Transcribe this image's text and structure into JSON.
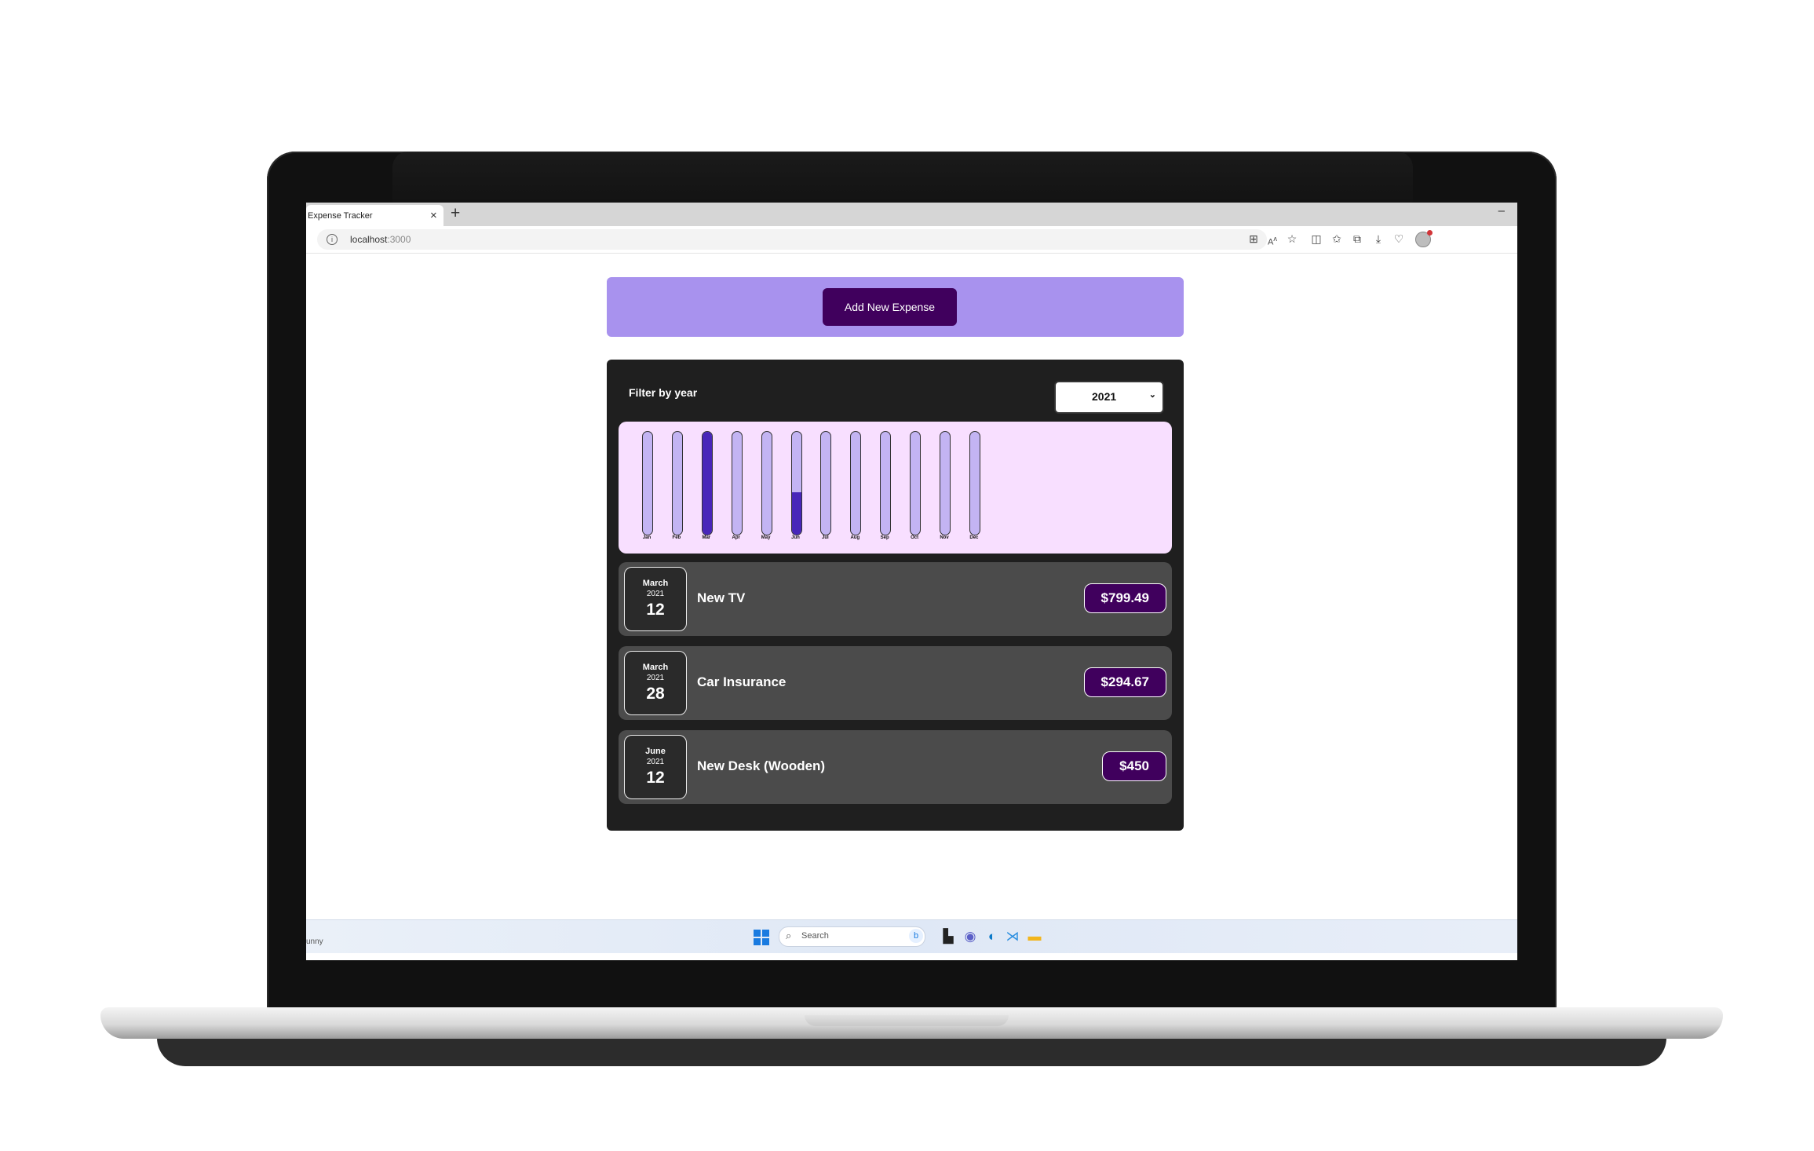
{
  "browser": {
    "tab_title": "Expense Tracker",
    "tab_close": "×",
    "new_tab": "+",
    "minimize": "–",
    "url_host": "localhost",
    "url_port": ":3000"
  },
  "toolbar_icons": [
    "apps-icon",
    "read-aloud-icon",
    "favorite-star-icon",
    "split-screen-icon",
    "favorites-icon",
    "collections-icon",
    "downloads-icon",
    "extensions-icon",
    "profile-icon"
  ],
  "app": {
    "add_button_label": "Add New Expense",
    "filter_label": "Filter by year",
    "selected_year": "2021",
    "colors": {
      "header_bg": "#a892ee",
      "button_bg": "#40005d",
      "panel_bg": "#1f1f1f",
      "chart_bg": "#f8dfff",
      "bar_fill": "#4826b9",
      "bar_empty": "#c3b4f3",
      "item_bg": "#4b4b4b"
    }
  },
  "chart_data": {
    "type": "bar",
    "categories": [
      "Jan",
      "Feb",
      "Mar",
      "Apr",
      "May",
      "Jun",
      "Jul",
      "Aug",
      "Sep",
      "Oct",
      "Nov",
      "Dec"
    ],
    "values": [
      0,
      0,
      1094.16,
      0,
      0,
      450,
      0,
      0,
      0,
      0,
      0,
      0
    ],
    "ylim": [
      0,
      1094.16
    ]
  },
  "expenses": [
    {
      "month": "March",
      "year": "2021",
      "day": "12",
      "title": "New TV",
      "amount": "$799.49"
    },
    {
      "month": "March",
      "year": "2021",
      "day": "28",
      "title": "Car Insurance",
      "amount": "$294.67"
    },
    {
      "month": "June",
      "year": "2021",
      "day": "12",
      "title": "New Desk (Wooden)",
      "amount": "$450"
    }
  ],
  "taskbar": {
    "weather_text": "unny",
    "search_placeholder": "Search",
    "apps": [
      "windows-start-icon",
      "task-view-icon",
      "chat-icon",
      "edge-browser-icon",
      "vscode-icon",
      "file-explorer-icon"
    ]
  }
}
